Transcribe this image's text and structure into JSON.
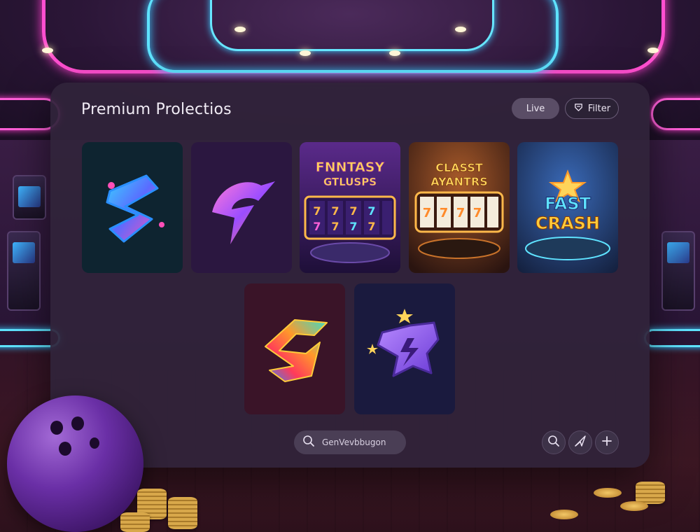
{
  "panel": {
    "title": "Premium Prolectios",
    "live_label": "Live",
    "filter_label": "Filter"
  },
  "games": [
    {
      "name": "Teal Swirl Logo",
      "icon": "swirl-logo-icon"
    },
    {
      "name": "Purple Bolt Logo",
      "icon": "bolt-logo-icon"
    },
    {
      "name": "FNNTASY GTLUSPS",
      "icon": "slot-machine-icon",
      "title_line1": "FNNTASY",
      "title_line2": "GTLUSPS"
    },
    {
      "name": "CLASST AYANTRS",
      "icon": "slot-machine-icon",
      "title_line1": "CLASST",
      "title_line2": "AYANTRS"
    },
    {
      "name": "FAST CRASH",
      "icon": "crash-game-icon",
      "title_line1": "FAST",
      "title_line2": "CRASH"
    },
    {
      "name": "Rainbow Arrow Logo",
      "icon": "arrow-logo-icon"
    },
    {
      "name": "Star Bolt Logo",
      "icon": "star-bolt-logo-icon"
    }
  ],
  "search": {
    "text": "GenVevbbugon",
    "icon": "search-icon"
  },
  "actions": [
    {
      "icon": "search-icon"
    },
    {
      "icon": "send-icon"
    },
    {
      "icon": "plus-icon"
    }
  ],
  "colors": {
    "panel_bg": "#30243a",
    "accent_cyan": "#5fe3ff",
    "accent_pink": "#ff4fd0"
  }
}
